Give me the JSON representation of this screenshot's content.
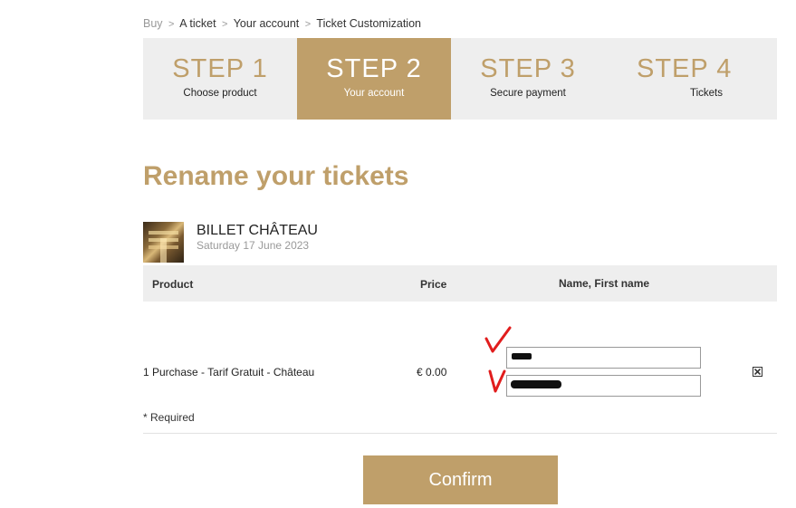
{
  "breadcrumb": {
    "items": [
      "Buy",
      "A ticket",
      "Your account",
      "Ticket Customization"
    ],
    "separator": ">"
  },
  "steps": [
    {
      "number": "STEP 1",
      "label": "Choose product",
      "active": false
    },
    {
      "number": "STEP 2",
      "label": "Your account",
      "active": true
    },
    {
      "number": "STEP 3",
      "label": "Secure payment",
      "active": false
    },
    {
      "number": "STEP 4",
      "label": "Tickets",
      "active": false
    }
  ],
  "page_title": "Rename your tickets",
  "ticket": {
    "name": "BILLET CHÂTEAU",
    "date": "Saturday 17 June 2023"
  },
  "table": {
    "headers": {
      "product": "Product",
      "price": "Price",
      "name": "Name, First name"
    },
    "rows": [
      {
        "product": "1 Purchase - Tarif Gratuit - Château",
        "price": "€ 0.00"
      }
    ]
  },
  "required_note": "* Required",
  "confirm_label": "Confirm",
  "colors": {
    "accent": "#bf9f6a",
    "panel": "#eeeeee",
    "annotation": "#e11d1d"
  },
  "icons": {
    "remove": "close-box-icon",
    "annotation": "red-checkmark-icon"
  }
}
